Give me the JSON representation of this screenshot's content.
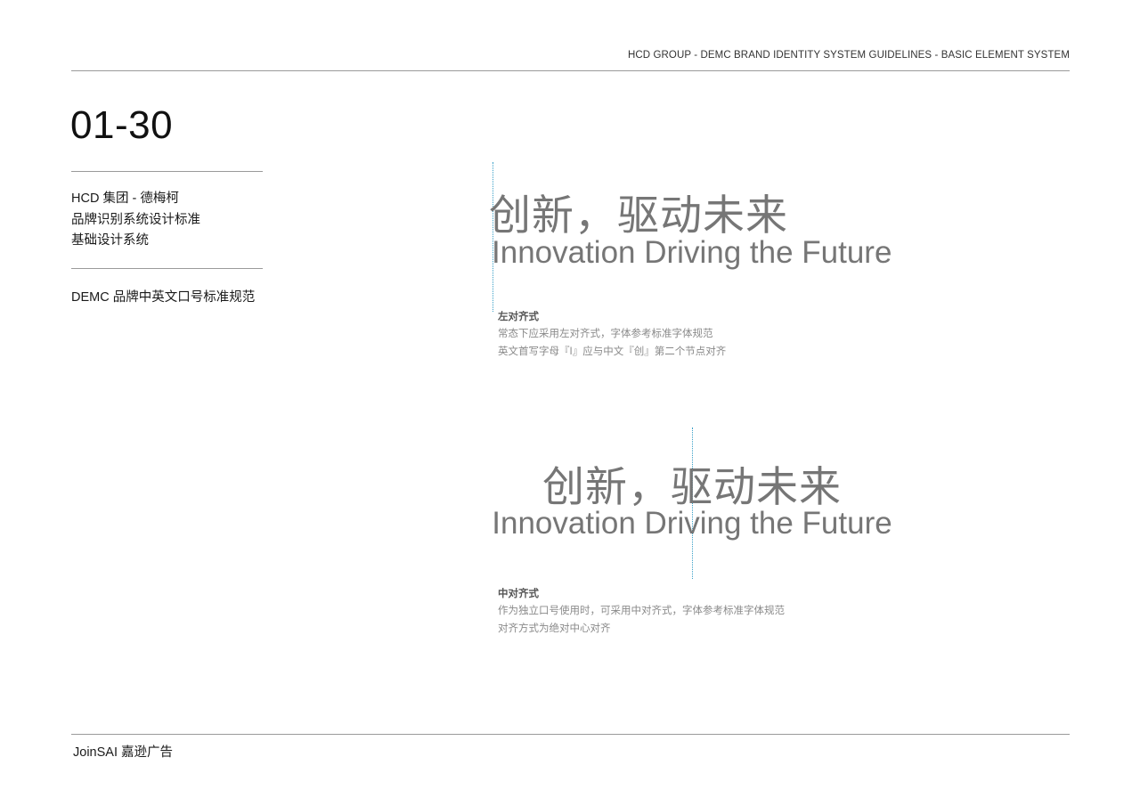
{
  "header": {
    "title": "HCD GROUP - DEMC BRAND IDENTITY SYSTEM GUIDELINES - BASIC ELEMENT SYSTEM"
  },
  "page_number": "01-30",
  "sidebar": {
    "title_lines": [
      "HCD 集团 - 德梅柯",
      "品牌识别系统设计标准",
      "基础设计系统"
    ],
    "section": "DEMC 品牌中英文口号标准规范"
  },
  "left_aligned": {
    "slogan_zh": "创新，驱动未来",
    "slogan_en": "Innovation Driving the Future",
    "note_title": "左对齐式",
    "note_lines": [
      "常态下应采用左对齐式，字体参考标准字体规范",
      "英文首写字母『I』应与中文『创』第二个节点对齐"
    ]
  },
  "center_aligned": {
    "slogan_zh": "创新，驱动未来",
    "slogan_en": "Innovation Driving the Future",
    "note_title": "中对齐式",
    "note_lines": [
      "作为独立口号使用时，可采用中对齐式，字体参考标准字体规范",
      "对齐方式为绝对中心对齐"
    ]
  },
  "footer": {
    "brand": "JoinSAI 嘉逊广告"
  },
  "colors": {
    "slogan": "#767676",
    "guide_line": "#3aa0c8",
    "rule": "#9a9a9a"
  }
}
